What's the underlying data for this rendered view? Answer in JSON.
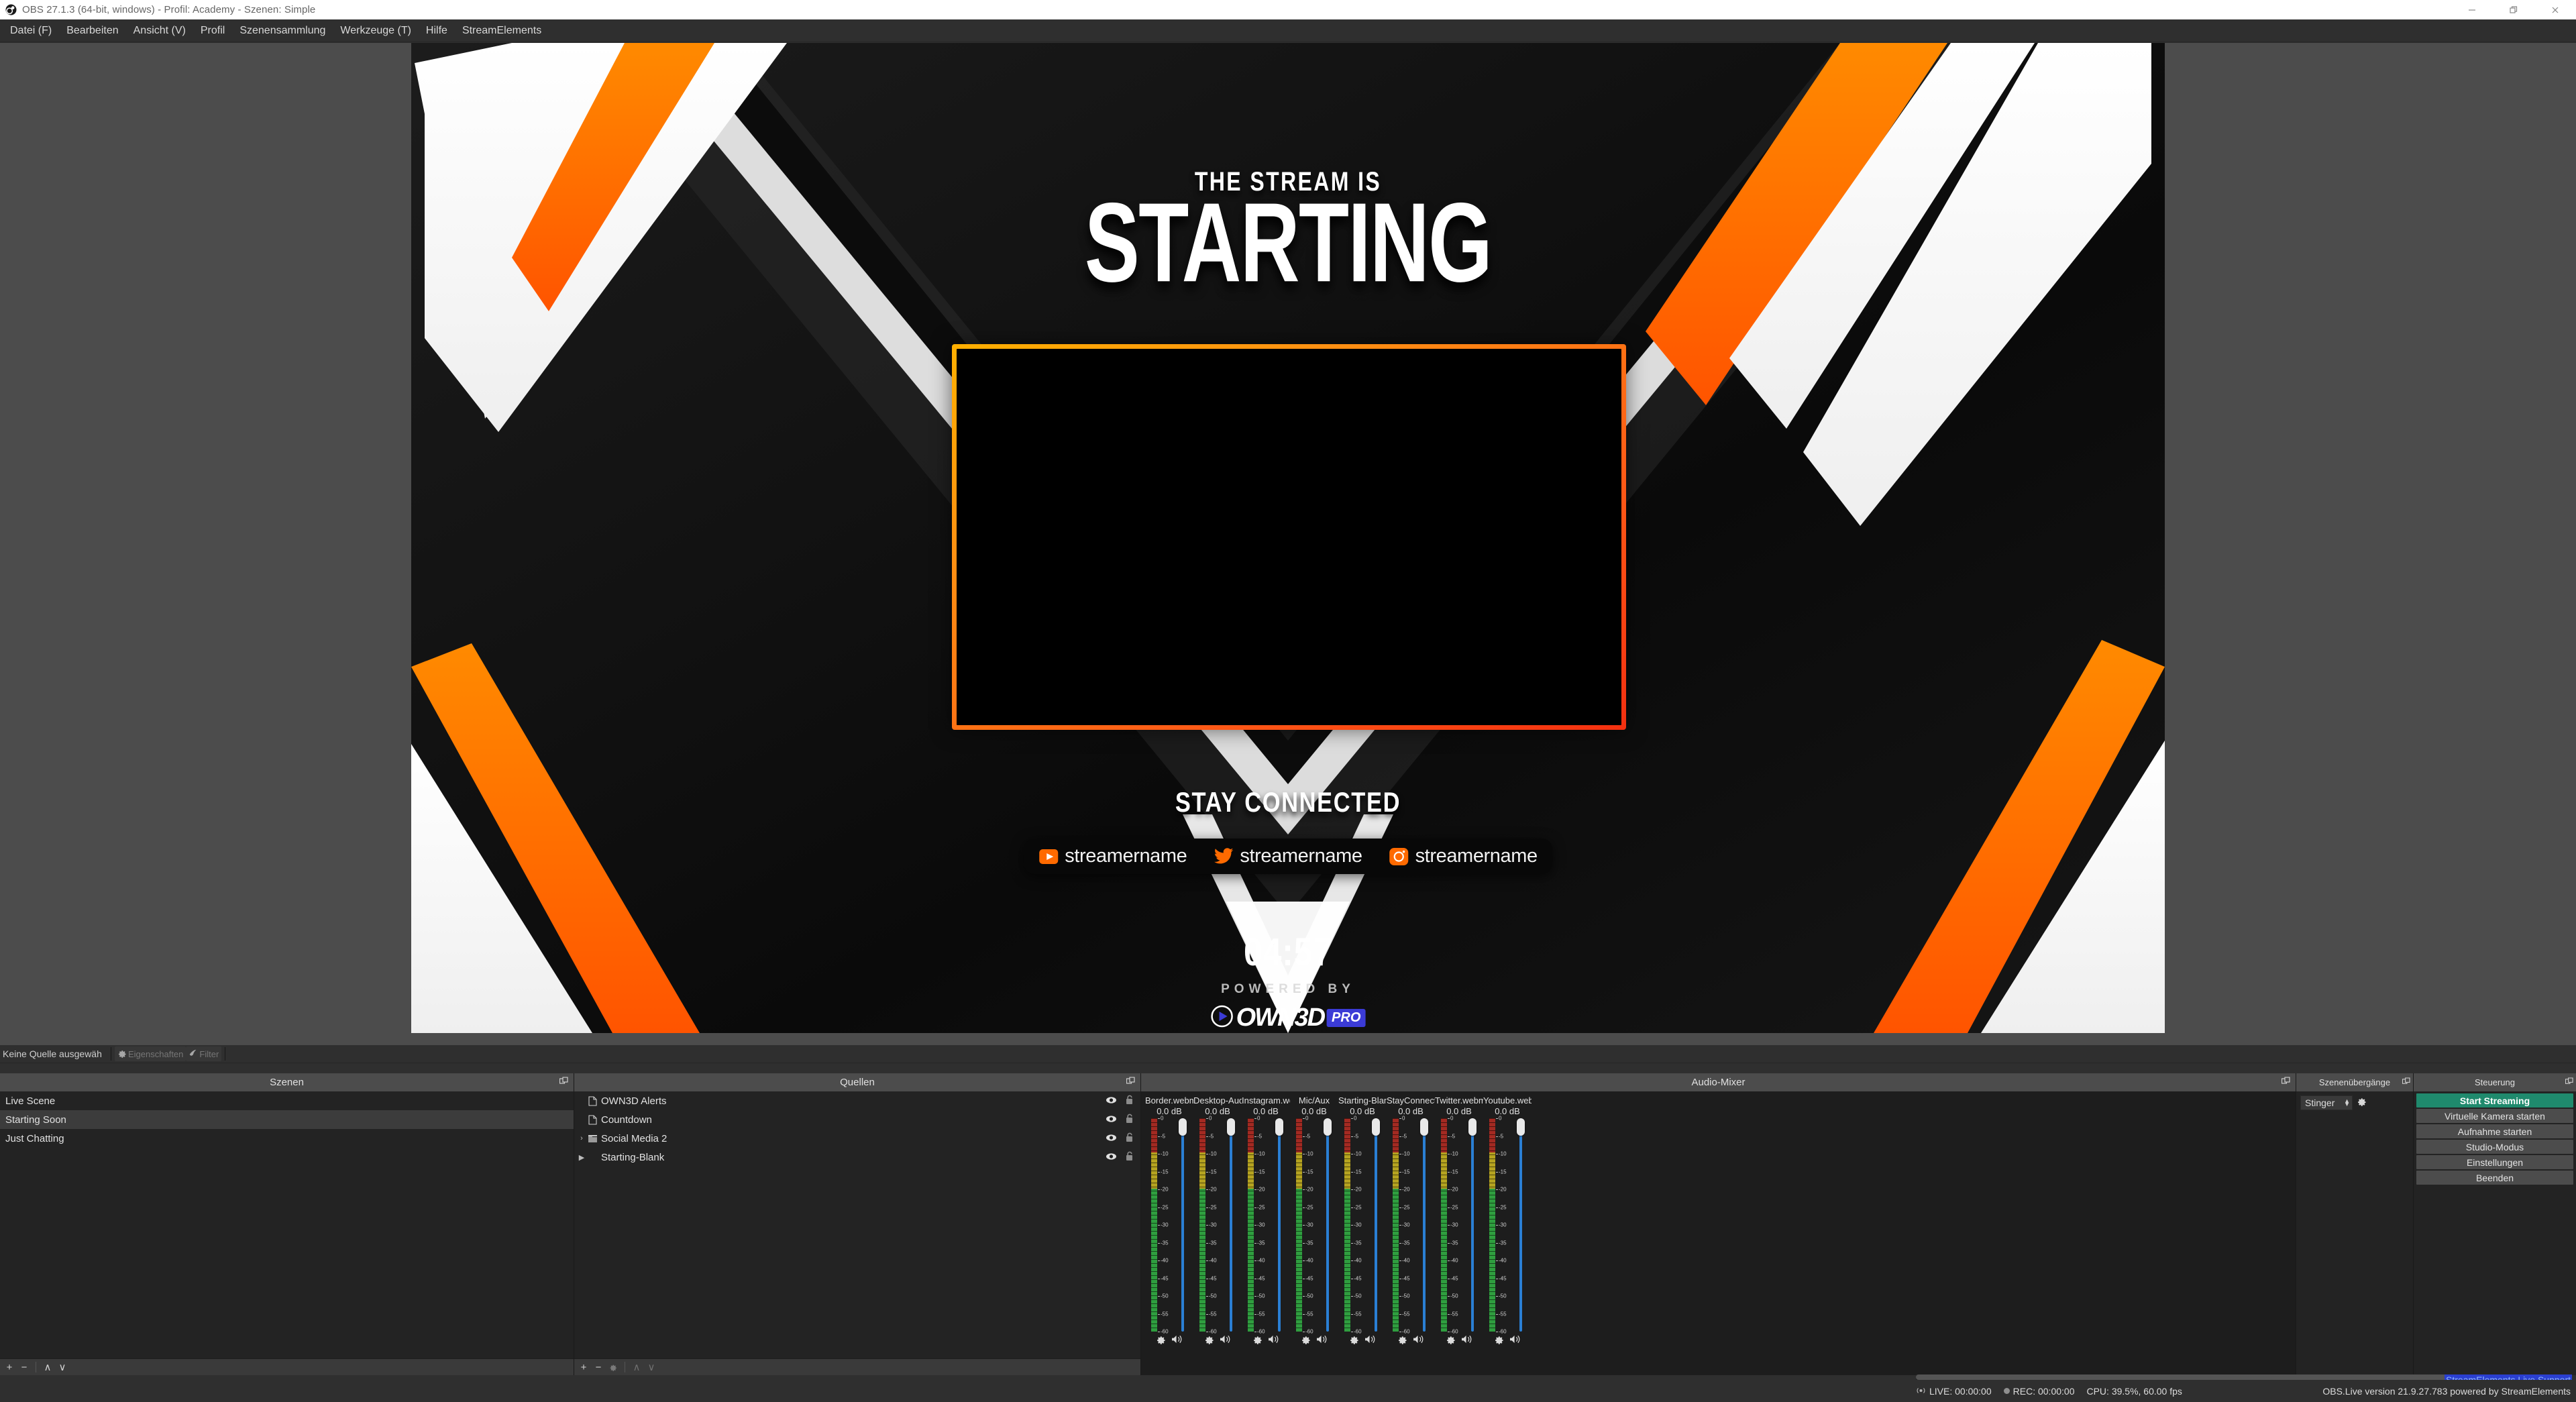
{
  "window": {
    "title": "OBS 27.1.3 (64-bit, windows) - Profil: Academy - Szenen: Simple",
    "logo_name": "obs-logo",
    "minimize": "minimize-icon",
    "restore": "restore-icon",
    "close": "close-icon"
  },
  "menubar": {
    "items": [
      {
        "label": "Datei (F)"
      },
      {
        "label": "Bearbeiten"
      },
      {
        "label": "Ansicht (V)"
      },
      {
        "label": "Profil"
      },
      {
        "label": "Szenensammlung"
      },
      {
        "label": "Werkzeuge (T)"
      },
      {
        "label": "Hilfe"
      },
      {
        "label": "StreamElements"
      }
    ]
  },
  "preview": {
    "overlay": {
      "subtitle": "THE STREAM IS",
      "title": "STARTING",
      "stay_connected": "STAY CONNECTED",
      "socials": [
        {
          "icon": "youtube-icon",
          "name": "streamername"
        },
        {
          "icon": "twitter-icon",
          "name": "streamername"
        },
        {
          "icon": "instagram-icon",
          "name": "streamername"
        }
      ],
      "timer": "04:57",
      "powered_by": "POWERED BY",
      "brand": "OWN3D",
      "brand_badge": "PRO"
    },
    "colors": {
      "accent_orange": "#ff6a00",
      "frame_top": "#ffb000",
      "frame_bottom": "#f43010"
    }
  },
  "source_toolbar": {
    "status": "Keine Quelle ausgewäh",
    "properties_label": "Eigenschaften",
    "properties_icon": "gear-icon",
    "filters_label": "Filter",
    "filters_icon": "filter-icon"
  },
  "scenes": {
    "title": "Szenen",
    "float_icon": "undock-icon",
    "items": [
      {
        "label": "Live Scene",
        "selected": false
      },
      {
        "label": "Starting Soon",
        "selected": true
      },
      {
        "label": "Just Chatting",
        "selected": false
      }
    ],
    "footer": {
      "add": "+",
      "remove": "−",
      "up": "∧",
      "down": "∨"
    }
  },
  "sources": {
    "title": "Quellen",
    "float_icon": "undock-icon",
    "items": [
      {
        "label": "OWN3D Alerts",
        "icon": "file-icon",
        "expander": "",
        "visible_icon": "eye-icon",
        "lock_icon": "unlock-icon"
      },
      {
        "label": "Countdown",
        "icon": "file-icon",
        "expander": "",
        "visible_icon": "eye-icon",
        "lock_icon": "unlock-icon"
      },
      {
        "label": "Social Media 2",
        "icon": "folder-icon",
        "expander": "›",
        "visible_icon": "eye-icon",
        "lock_icon": "unlock-icon"
      },
      {
        "label": "Starting-Blank",
        "icon": "",
        "expander": "▶",
        "visible_icon": "eye-icon",
        "lock_icon": "unlock-icon"
      }
    ],
    "footer": {
      "add": "+",
      "remove": "−",
      "settings": "gear-icon",
      "up": "∧",
      "down": "∨"
    }
  },
  "mixer": {
    "title": "Audio-Mixer",
    "float_icon": "undock-icon",
    "scale_labels": [
      "0",
      "-5",
      "-10",
      "-15",
      "-20",
      "-25",
      "-30",
      "-35",
      "-40",
      "-45",
      "-50",
      "-55",
      "-60"
    ],
    "channels": [
      {
        "name": "Border.webm",
        "db": "0.0 dB",
        "gear": "gear-icon",
        "speaker": "speaker-icon"
      },
      {
        "name": "Desktop-Audio",
        "db": "0.0 dB",
        "gear": "gear-icon",
        "speaker": "speaker-icon"
      },
      {
        "name": "Instagram.webm",
        "db": "0.0 dB",
        "gear": "gear-icon",
        "speaker": "speaker-icon"
      },
      {
        "name": "Mic/Aux",
        "db": "0.0 dB",
        "gear": "gear-icon",
        "speaker": "speaker-icon"
      },
      {
        "name": "Starting-Blank",
        "db": "0.0 dB",
        "gear": "gear-icon",
        "speaker": "speaker-icon"
      },
      {
        "name": "StayConnected.\\",
        "db": "0.0 dB",
        "gear": "gear-icon",
        "speaker": "speaker-icon"
      },
      {
        "name": "Twitter.webm",
        "db": "0.0 dB",
        "gear": "gear-icon",
        "speaker": "speaker-icon"
      },
      {
        "name": "Youtube.webm",
        "db": "0.0 dB",
        "gear": "gear-icon",
        "speaker": "speaker-icon"
      }
    ]
  },
  "transitions": {
    "title": "Szenenübergänge",
    "float_icon": "undock-icon",
    "selected": "Stinger",
    "gear_icon": "gear-icon"
  },
  "controls": {
    "title": "Steuerung",
    "float_icon": "undock-icon",
    "buttons": [
      {
        "label": "Start Streaming",
        "primary": true
      },
      {
        "label": "Virtuelle Kamera starten",
        "primary": false
      },
      {
        "label": "Aufnahme starten",
        "primary": false
      },
      {
        "label": "Studio-Modus",
        "primary": false
      },
      {
        "label": "Einstellungen",
        "primary": false
      },
      {
        "label": "Beenden",
        "primary": false
      }
    ]
  },
  "statusbar": {
    "live_icon": "broadcast-icon",
    "live": "LIVE: 00:00:00",
    "rec_icon": "record-dot-icon",
    "rec": "REC: 00:00:00",
    "cpu": "CPU: 39.5%, 60.00 fps",
    "version": "OBS.Live version 21.9.27.783 powered by StreamElements",
    "se_support": "StreamElements Live Support"
  }
}
